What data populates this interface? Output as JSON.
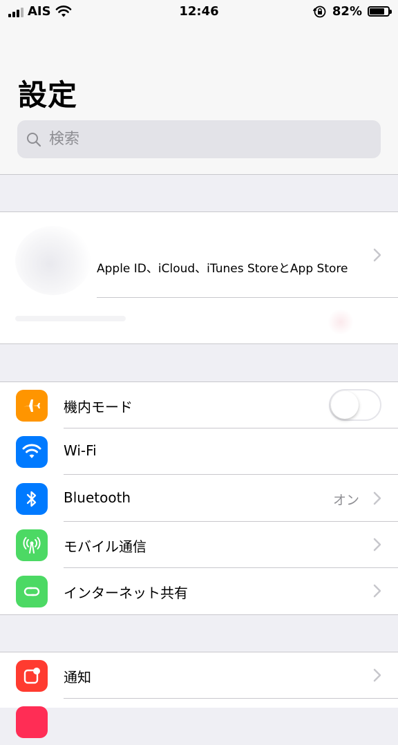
{
  "status_bar": {
    "carrier": "AIS",
    "time": "12:46",
    "battery_percent": "82%",
    "battery_level": 0.82
  },
  "header": {
    "title": "設定",
    "search_placeholder": "検索"
  },
  "apple_id": {
    "label": "Apple ID、iCloud、iTunes StoreとApp Store"
  },
  "network_group": [
    {
      "label": "機内モード",
      "icon": "airplane-icon",
      "color": "#ff9500",
      "control": "toggle",
      "on": false
    },
    {
      "label": "Wi-Fi",
      "icon": "wifi-icon",
      "color": "#007aff",
      "value": ""
    },
    {
      "label": "Bluetooth",
      "icon": "bluetooth-icon",
      "color": "#007aff",
      "value": "オン"
    },
    {
      "label": "モバイル通信",
      "icon": "antenna-icon",
      "color": "#4cd964"
    },
    {
      "label": "インターネット共有",
      "icon": "hotspot-icon",
      "color": "#4cd964"
    }
  ],
  "notify_group": [
    {
      "label": "通知",
      "icon": "notifications-icon",
      "color": "#ff3b30"
    }
  ]
}
